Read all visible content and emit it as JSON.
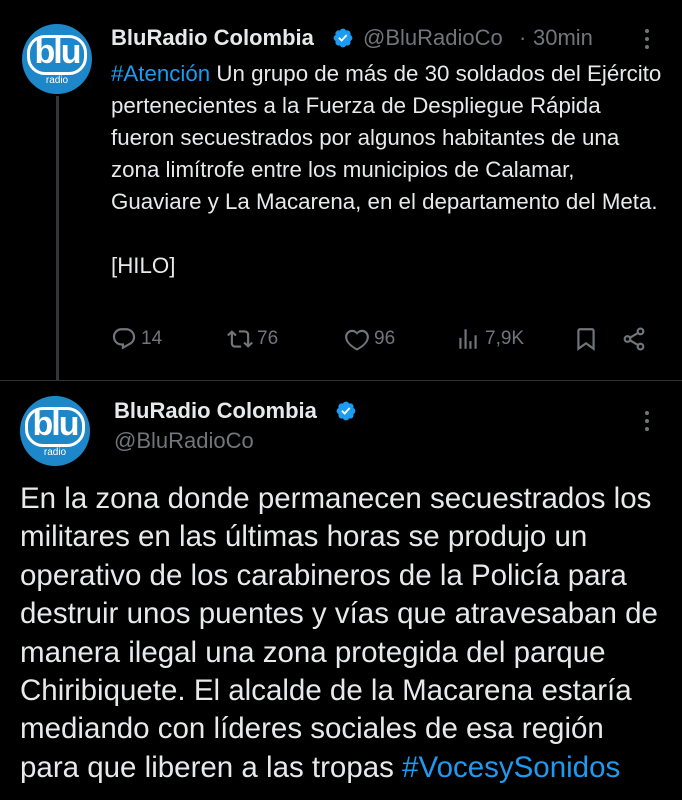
{
  "tweet1": {
    "author_name": "BluRadio Colombia",
    "handle": "@BluRadioCo",
    "separator": "·",
    "time": "30min",
    "avatar": {
      "logo_text": "blu",
      "logo_subtext": "radio",
      "color": "#1d87c9"
    },
    "hashtag": "#Atención",
    "text": " Un grupo de más de 30 soldados del Ejército pertenecientes a la Fuerza de Despliegue Rápida fueron secuestrados por algunos habitantes de una zona limítrofe entre los municipios de Calamar, Guaviare y La Macarena, en el departamento del Meta.",
    "text2": "[HILO]",
    "actions": {
      "replies": "14",
      "retweets": "76",
      "likes": "96",
      "views": "7,9K"
    }
  },
  "tweet2": {
    "author_name": "BluRadio Colombia",
    "handle": "@BluRadioCo",
    "avatar": {
      "logo_text": "blu",
      "logo_subtext": "radio",
      "color": "#1d87c9"
    },
    "text": "En la zona donde permanecen secuestrados los militares en las últimas horas se produjo un operativo de los carabineros de la Policía para destruir unos puentes y vías que atravesaban de manera ilegal una zona protegida del parque Chiribiquete. El alcalde de la Macarena estaría mediando con líderes sociales de esa región para que liberen a las tropas ",
    "hashtag": "#VocesySonidos"
  },
  "colors": {
    "background": "#000000",
    "text": "#e7e9ea",
    "muted": "#71767b",
    "link": "#1d9bf0",
    "verified": "#1d9bf0"
  }
}
